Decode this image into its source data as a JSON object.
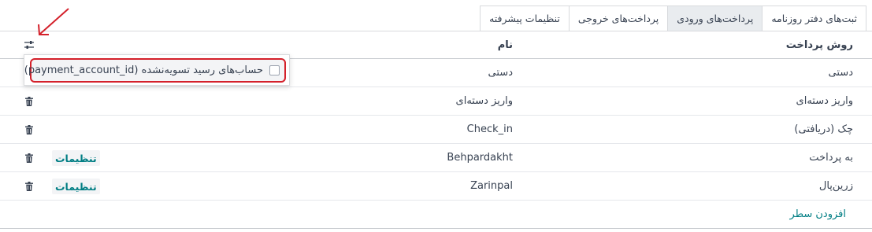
{
  "tabs": [
    {
      "label": "ثبت‌های دفتر روزنامه",
      "active": false
    },
    {
      "label": "پرداخت‌های ورودی",
      "active": true
    },
    {
      "label": "پرداخت‌های خروجی",
      "active": false
    },
    {
      "label": "تنظیمات پیشرفته",
      "active": false
    }
  ],
  "table": {
    "headers": {
      "method": "روش پرداخت",
      "name": "نام"
    },
    "rows": [
      {
        "method": "دستی",
        "name": "دستی",
        "settings": ""
      },
      {
        "method": "واریز دسته‌ای",
        "name": "واریز دسته‌ای",
        "settings": ""
      },
      {
        "method": "چک (دریافتی)",
        "name": "Check_in",
        "settings": ""
      },
      {
        "method": "به پرداخت",
        "name": "Behpardakht",
        "settings": "تنظیمات"
      },
      {
        "method": "زرین‌پال",
        "name": "Zarinpal",
        "settings": "تنظیمات"
      }
    ],
    "add_line": "افزودن سطر"
  },
  "optional_columns": {
    "items": [
      {
        "label": "حساب‌های رسید تسویه‌نشده (payment_account_id)",
        "checked": false
      }
    ]
  },
  "icons": {
    "column_toggle": "sliders-icon",
    "trash": "trash-icon",
    "annotation_arrow": "arrow-icon"
  },
  "colors": {
    "accent": "#017e84",
    "highlight": "#d4202a",
    "active_tab": "#e9ecef"
  }
}
